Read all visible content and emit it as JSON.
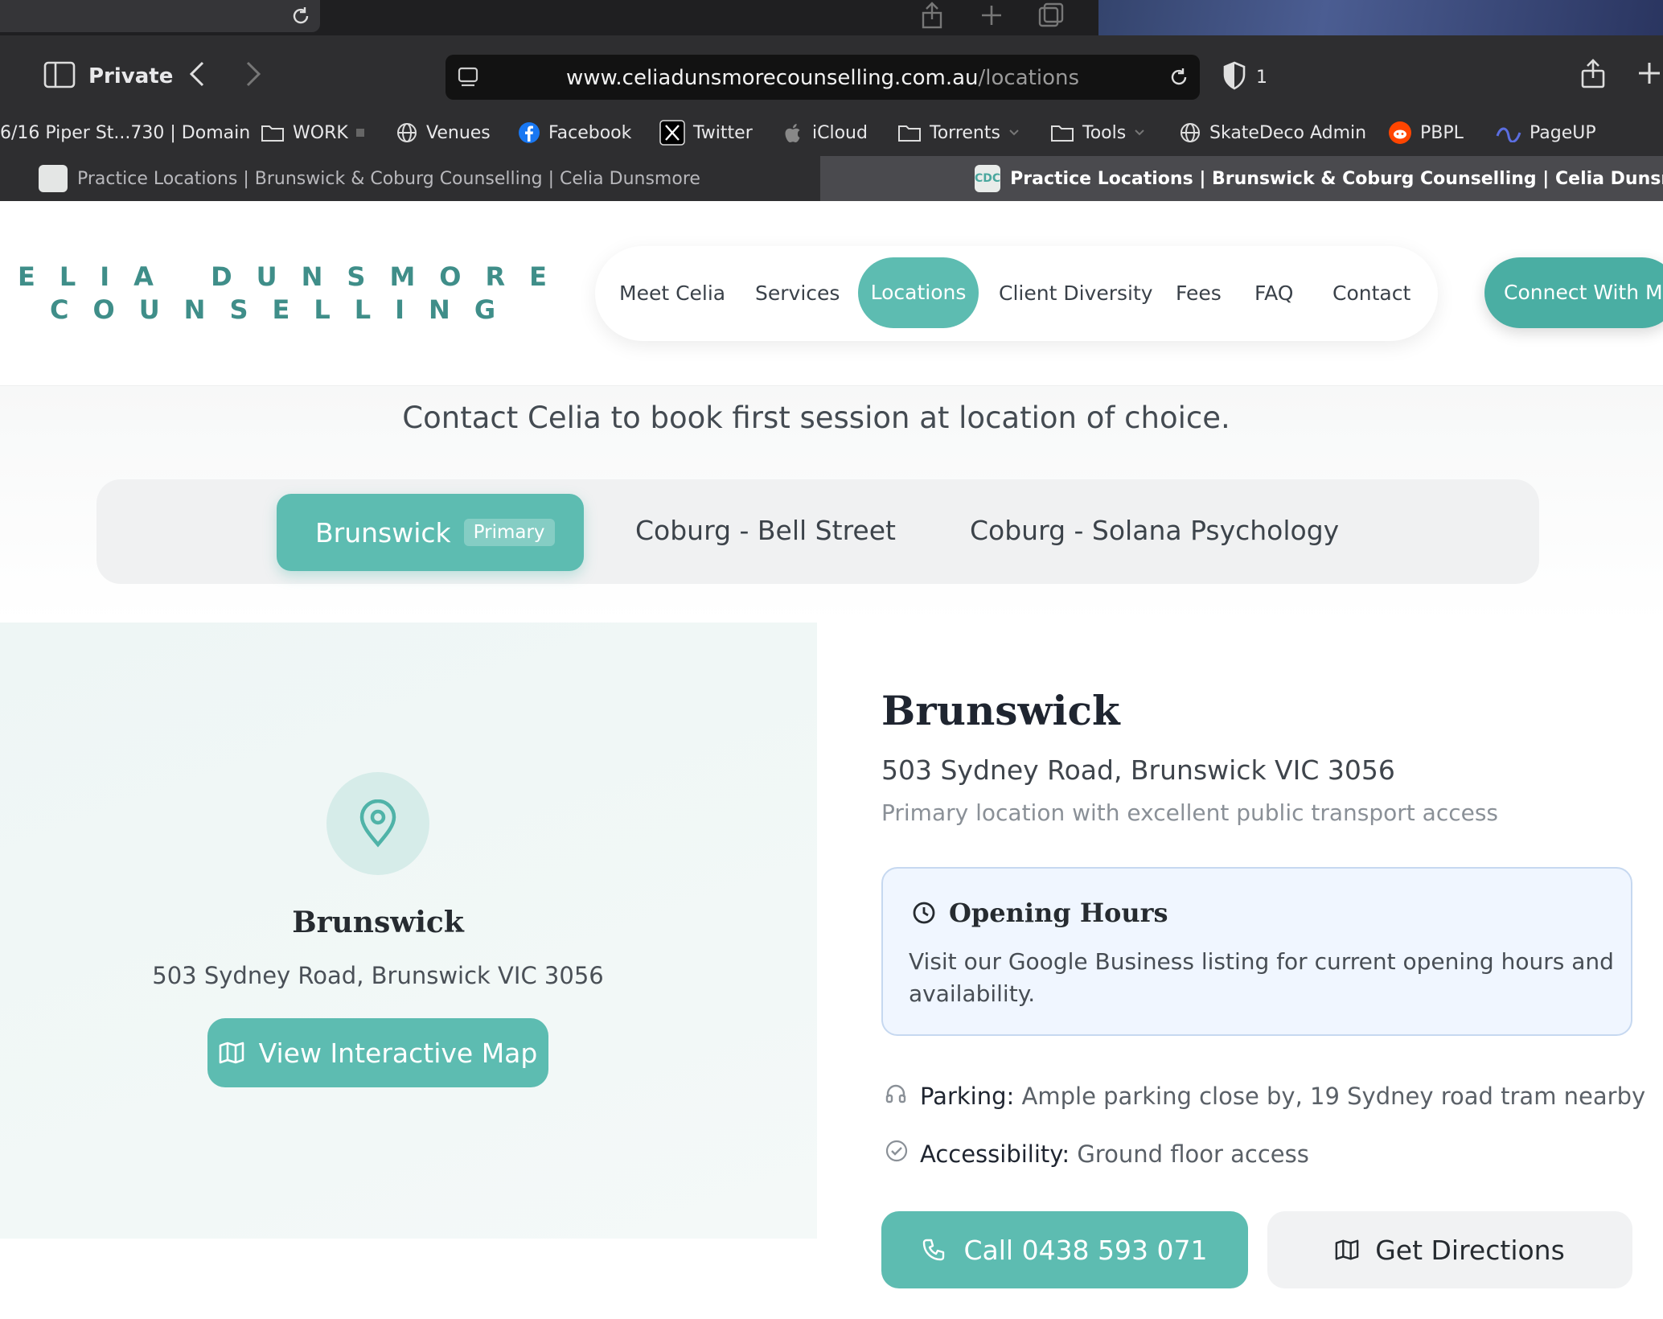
{
  "browser": {
    "mode_label": "Private",
    "url_domain": "www.celiadunsmorecounselling.com.au",
    "url_path": "/locations",
    "shield_count": "1",
    "bookmarks": [
      {
        "label": "6/16 Piper St...730 | Domain",
        "icon": "none"
      },
      {
        "label": "WORK",
        "icon": "folder-icon"
      },
      {
        "label": "Venues",
        "icon": "globe-icon"
      },
      {
        "label": "Facebook",
        "icon": "facebook-icon"
      },
      {
        "label": "Twitter",
        "icon": "x-icon"
      },
      {
        "label": "iCloud",
        "icon": "apple-icon"
      },
      {
        "label": "Torrents",
        "icon": "folder-icon"
      },
      {
        "label": "Tools",
        "icon": "folder-icon"
      },
      {
        "label": "SkateDeco Admin",
        "icon": "globe-icon"
      },
      {
        "label": "PBPL",
        "icon": "reddit-icon"
      },
      {
        "label": "PageUP",
        "icon": "pageup-icon"
      }
    ],
    "tabs": [
      {
        "title": "Practice Locations | Brunswick & Coburg Counselling | Celia Dunsmore",
        "active": false
      },
      {
        "title": "Practice Locations | Brunswick & Coburg Counselling | Celia Dunsmore",
        "active": true
      }
    ],
    "favicon_text": "CDC"
  },
  "site": {
    "logo_line1": "ELIA DUNSMORE",
    "logo_line2": "COUNSELLING",
    "nav": [
      "Meet Celia",
      "Services",
      "Locations",
      "Client Diversity",
      "Fees",
      "FAQ",
      "Contact"
    ],
    "nav_active": "Locations",
    "cta": "Connect With Me",
    "accent": "#5dbcb1"
  },
  "intro": "Contact Celia to book first session at location of choice.",
  "location_tabs": {
    "items": [
      "Brunswick",
      "Coburg - Bell Street",
      "Coburg - Solana Psychology"
    ],
    "primary_badge": "Primary"
  },
  "map_panel": {
    "title": "Brunswick",
    "address": "503 Sydney Road, Brunswick VIC 3056",
    "button": "View Interactive Map"
  },
  "details": {
    "title": "Brunswick",
    "address": "503 Sydney Road, Brunswick VIC 3056",
    "description": "Primary location with excellent public transport access",
    "hours_title": "Opening Hours",
    "hours_body": "Visit our Google Business listing for current opening hours and availability.",
    "parking_label": "Parking:",
    "parking_value": "Ample parking close by, 19 Sydney road tram nearby",
    "access_label": "Accessibility:",
    "access_value": "Ground floor access",
    "call_button": "Call 0438 593 071",
    "directions_button": "Get Directions"
  }
}
